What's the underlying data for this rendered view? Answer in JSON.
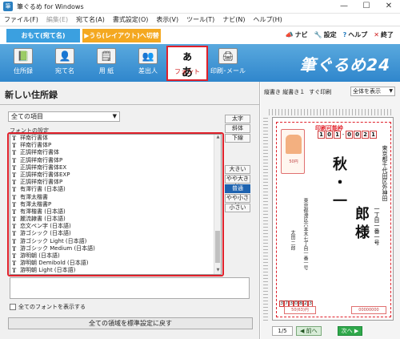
{
  "window": {
    "title": "筆ぐるめ for Windows",
    "icon_glyph": "筆",
    "minimize": "—",
    "maximize": "☐",
    "close": "✕"
  },
  "menubar": [
    {
      "label": "ファイル(F)",
      "disabled": false
    },
    {
      "label": "編集(E)",
      "disabled": true
    },
    {
      "label": "宛て名(A)",
      "disabled": false
    },
    {
      "label": "書式設定(O)",
      "disabled": false
    },
    {
      "label": "表示(V)",
      "disabled": false
    },
    {
      "label": "ツール(T)",
      "disabled": false
    },
    {
      "label": "ナビ(N)",
      "disabled": false
    },
    {
      "label": "ヘルプ(H)",
      "disabled": false
    }
  ],
  "modes": {
    "front": "おもて(宛て名)",
    "back": "▶うら(レイアウト)へ切替"
  },
  "toplinks": {
    "navi": "ナビ",
    "settings": "設定",
    "help": "ヘルプ",
    "exit": "終了",
    "navi_icon": "📣",
    "settings_icon": "🔧",
    "help_icon": "?",
    "exit_icon": "✕"
  },
  "toolbar": {
    "brand": "筆ぐるめ24",
    "items": [
      {
        "label": "住所録",
        "icon": "📗"
      },
      {
        "label": "宛て名",
        "icon": "👤"
      },
      {
        "label": "用 紙",
        "icon": "🗒"
      },
      {
        "label": "差出人",
        "icon": "👥"
      },
      {
        "label": "フォント",
        "icon": "ぁあ"
      },
      {
        "label": "印刷･メール",
        "icon": "🖨"
      }
    ]
  },
  "left_panel": {
    "title": "新しい住所録",
    "filter_value": "全ての項目",
    "font_section_label": "フォントの設定",
    "fonts": [
      "祥南行書体",
      "祥南行書体P",
      "正調祥南行書体",
      "正調祥南行書体P",
      "正調祥南行書体EX",
      "正調祥南行書体EXP",
      "正調祥南行書体P",
      "有澤行書 (日本語)",
      "有澤太楷書",
      "有澤太楷書P",
      "有澤楷書 (日本語)",
      "麗流隷書 (日本語)",
      "恋文ペン字 (日本語)",
      "游ゴシック (日本語)",
      "游ゴシック Light (日本語)",
      "游ゴシック Medium (日本語)",
      "游明朝 (日本語)",
      "游明朝 Demibold (日本語)",
      "游明朝 Light (日本語)"
    ],
    "style_buttons": [
      "太字",
      "斜体",
      "下線"
    ],
    "size_buttons": [
      "大きい",
      "やや大きい",
      "普通",
      "やや小さい",
      "小さい"
    ],
    "size_selected": "普通",
    "show_all_label": "全てのフォントを表示する",
    "reset_label": "全ての領域を標準設定に戻す",
    "tt_glyph": "T"
  },
  "right_panel": {
    "orientation_label": "縦書き 縦書き１",
    "print_label": "すぐ印刷",
    "view_select": "全体を表示",
    "postcard": {
      "printable_label": "印刷可能枠",
      "stamp_text": "50円",
      "zip_top": [
        "1",
        "0",
        "1",
        "0",
        "0",
        "2",
        "1"
      ],
      "address_col1": "東京都千代田区外神田",
      "address_col2": "一丁目一番一号",
      "recipient_part1": "秋・一",
      "recipient_part2": "郎様",
      "sender_address": "東京都港区六本木七丁目一番一号",
      "sender_name": "太田 二郎",
      "zip_bottom": [
        "3",
        "7",
        "3",
        "0",
        "8",
        "2",
        "3"
      ],
      "barcode1": "50(63)円",
      "barcode2": "00000000"
    },
    "pager": {
      "page": "1/5",
      "prev": "◀ 前へ",
      "next": "次へ ▶"
    }
  }
}
